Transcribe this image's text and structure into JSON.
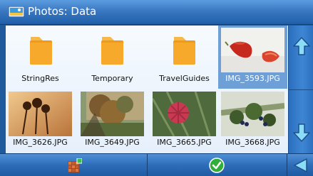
{
  "window": {
    "title": "Photos: Data"
  },
  "items": [
    {
      "name": "StringRes",
      "kind": "folder",
      "icon": "folder-icon"
    },
    {
      "name": "Temporary",
      "kind": "folder",
      "icon": "folder-icon"
    },
    {
      "name": "TravelGuides",
      "kind": "folder",
      "icon": "folder-icon"
    },
    {
      "name": "IMG_3593.JPG",
      "kind": "image",
      "selected": true
    },
    {
      "name": "IMG_3626.JPG",
      "kind": "image"
    },
    {
      "name": "IMG_3649.JPG",
      "kind": "image"
    },
    {
      "name": "IMG_3665.JPG",
      "kind": "image"
    },
    {
      "name": "IMG_3668.JPG",
      "kind": "image"
    }
  ],
  "scroll": {
    "up_icon": "arrow-up-icon",
    "down_icon": "arrow-down-icon"
  },
  "toolbar": {
    "view_icon": "grid-view-icon",
    "ok_icon": "checkmark-icon",
    "back_icon": "back-arrow-icon"
  },
  "colors": {
    "accent": "#2f6fbd",
    "selection": "#6e9fd6",
    "folder": "#f5a623",
    "arrow": "#7fd6f5"
  }
}
